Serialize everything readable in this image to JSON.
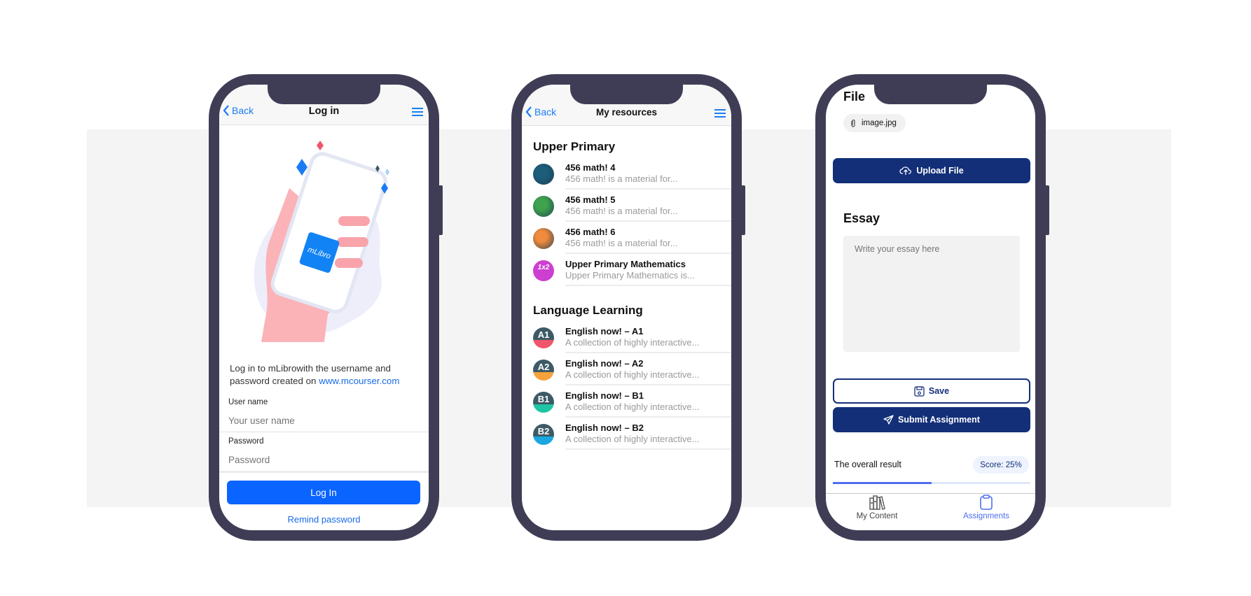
{
  "login": {
    "back": "Back",
    "title": "Log in",
    "logo_text": "mLibro",
    "intro_text": "Log in to mLibrowith the username and password created on ",
    "intro_link": "www.mcourser.com",
    "username_label": "User name",
    "username_placeholder": "Your user name",
    "password_label": "Password",
    "password_placeholder": "Password",
    "login_button": "Log In",
    "remind_link": "Remind password"
  },
  "resources": {
    "back": "Back",
    "title": "My resources",
    "sections": [
      {
        "title": "Upper Primary",
        "items": [
          {
            "title": "456 math! 4",
            "subtitle": "456 math! is a material for...",
            "color": "#1c5d7a"
          },
          {
            "title": "456 math! 5",
            "subtitle": "456 math! is a material for...",
            "color": "#3fa34d"
          },
          {
            "title": "456 math! 6",
            "subtitle": "456 math! is a material for...",
            "color": "#f08a3c"
          },
          {
            "title": "Upper Primary Mathematics",
            "subtitle": "Upper Primary Mathematics is...",
            "color": "#cc3fd0",
            "badge": "1x2"
          }
        ]
      },
      {
        "title": "Language Learning",
        "items": [
          {
            "title": "English now! – A1",
            "subtitle": "A collection of highly interactive...",
            "badge": "A1",
            "color": "#f0566b"
          },
          {
            "title": "English now! – A2",
            "subtitle": "A collection of highly interactive...",
            "badge": "A2",
            "color": "#f7a23b"
          },
          {
            "title": "English now! – B1",
            "subtitle": "A collection of highly interactive...",
            "badge": "B1",
            "color": "#1fc6a4"
          },
          {
            "title": "English now! – B2",
            "subtitle": "A collection of highly interactive...",
            "badge": "B2",
            "color": "#1aa7e0"
          }
        ]
      }
    ]
  },
  "assignment": {
    "file_heading": "File",
    "file_name": "image.jpg",
    "upload_button": "Upload File",
    "essay_heading": "Essay",
    "essay_placeholder": "Write your essay here",
    "save_button": "Save",
    "submit_button": "Submit Assignment",
    "result_label": "The overall result",
    "score_badge": "Score: 25%",
    "progress_fraction": 0.5,
    "tabs": [
      {
        "label": "My Content",
        "icon": "books-icon",
        "active": false
      },
      {
        "label": "Assignments",
        "icon": "clipboard-icon",
        "active": true
      }
    ]
  },
  "colors": {
    "phone_frame": "#3f3d56",
    "primary_blue": "#0a64ff",
    "navy": "#132f78",
    "accent": "#4d6ef0"
  }
}
